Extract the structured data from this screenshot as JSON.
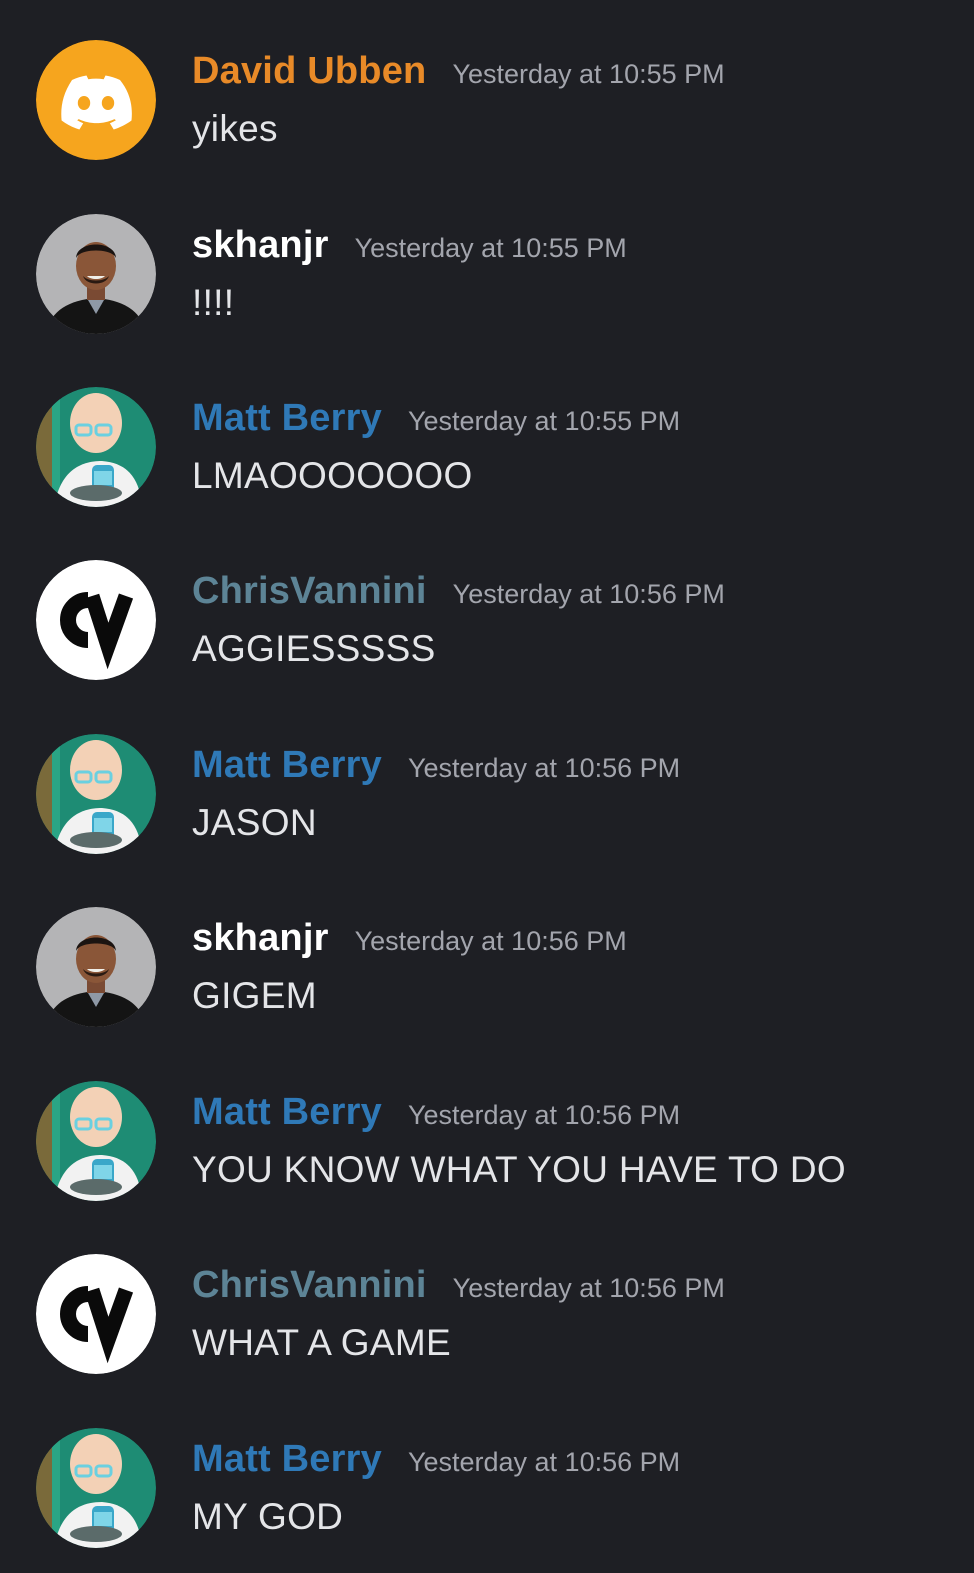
{
  "colors": {
    "background": "#1e1f24",
    "timestamp": "#a3a5ad",
    "message_text": "#e4e5e8",
    "david_name": "#e88a28",
    "skhanjr_name": "#ffffff",
    "matt_name": "#2f79b7",
    "chris_name": "#5d8496"
  },
  "messages": [
    {
      "author": "David Ubben",
      "time": "Yesterday at 10:55 PM",
      "text": "yikes",
      "avatar": "discord-logo-icon"
    },
    {
      "author": "skhanjr",
      "time": "Yesterday at 10:55 PM",
      "text": "!!!!",
      "avatar": "person-photo"
    },
    {
      "author": "Matt Berry",
      "time": "Yesterday at 10:55 PM",
      "text": "LMAOOOOOOO",
      "avatar": "cartoon-professor"
    },
    {
      "author": "ChrisVannini",
      "time": "Yesterday at 10:56 PM",
      "text": "AGGIESSSSS",
      "avatar": "cv-logo"
    },
    {
      "author": "Matt Berry",
      "time": "Yesterday at 10:56 PM",
      "text": "JASON",
      "avatar": "cartoon-professor"
    },
    {
      "author": "skhanjr",
      "time": "Yesterday at 10:56 PM",
      "text": "GIGEM",
      "avatar": "person-photo"
    },
    {
      "author": "Matt Berry",
      "time": "Yesterday at 10:56 PM",
      "text": "YOU KNOW WHAT YOU HAVE TO DO",
      "avatar": "cartoon-professor"
    },
    {
      "author": "ChrisVannini",
      "time": "Yesterday at 10:56 PM",
      "text": "WHAT A GAME",
      "avatar": "cv-logo"
    },
    {
      "author": "Matt Berry",
      "time": "Yesterday at 10:56 PM",
      "text": "MY GOD",
      "avatar": "cartoon-professor"
    }
  ]
}
